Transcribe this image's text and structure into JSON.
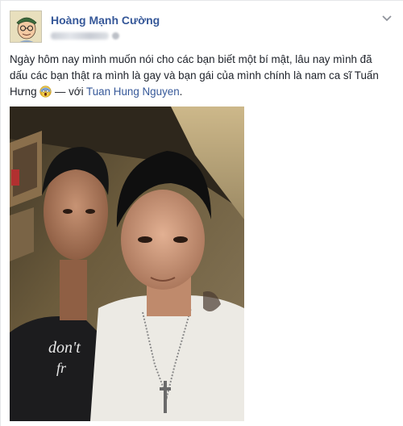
{
  "post": {
    "author_name": "Hoàng Mạnh Cường",
    "text_main": "Ngày hôm nay mình muốn nói cho các bạn biết một bí mật, lâu nay mình đã dấu các bạn thật ra mình là gay và bạn gái của mình chính là nam ca sĩ Tuấn Hưng",
    "text_with": " — với ",
    "tagged_name": "Tuan Hung Nguyen",
    "text_end": ".",
    "emoji_icon": "screaming-face-icon"
  },
  "colors": {
    "link": "#365899",
    "text": "#1d2129"
  }
}
